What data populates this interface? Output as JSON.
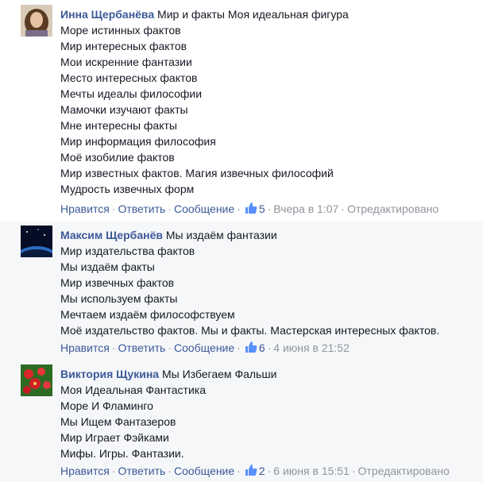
{
  "comments": [
    {
      "author": "Инна Щербанёва",
      "text": "Мир и факты Моя идеальная фигура",
      "lines": [
        "Море истинных фактов",
        "Мир интересных фактов",
        "Мои искренние фантазии",
        "Место интересных фактов",
        "Мечты идеалы философии",
        "Мамочки изучают факты",
        "Мне интересны факты",
        "Мир информация философия",
        "Моё изобилие фактов",
        "Мир известных фактов. Магия извечных философий",
        "Мудрость извечных форм"
      ],
      "actions": {
        "like": "Нравится",
        "reply": "Ответить",
        "message": "Сообщение",
        "likes": "5",
        "time": "Вчера в 1:07",
        "edited": "Отредактировано"
      }
    },
    {
      "author": "Максим Щербанёв",
      "text": "Мы издаём фантазии",
      "lines": [
        "Мир издательства фактов",
        "Мы издаём факты",
        "Мир извечных фактов",
        "Мы используем факты",
        "Мечтаем издаём философствуем",
        "Моё издательство фактов. Мы и факты. Мастерская интересных фактов."
      ],
      "actions": {
        "like": "Нравится",
        "reply": "Ответить",
        "message": "Сообщение",
        "likes": "6",
        "time": "4 июня в 21:52"
      }
    },
    {
      "author": "Виктория Щукина",
      "text": "Мы Избегаем Фальши",
      "lines": [
        "Моя Идеальная Фантастика",
        "Море И Фламинго",
        "Мы Ищем Фантазеров",
        "Мир Играет Фэйками",
        "Мифы. Игры. Фантазии."
      ],
      "actions": {
        "like": "Нравится",
        "reply": "Ответить",
        "message": "Сообщение",
        "likes": "2",
        "time": "6 июня в 15:51",
        "edited": "Отредактировано"
      }
    }
  ],
  "sep": "·",
  "colors": {
    "link": "#3b5998",
    "meta": "#90949c",
    "text": "#141823",
    "highlight_bg": "#f6f7f9"
  },
  "icons": {
    "like": "thumbs-up-icon"
  }
}
